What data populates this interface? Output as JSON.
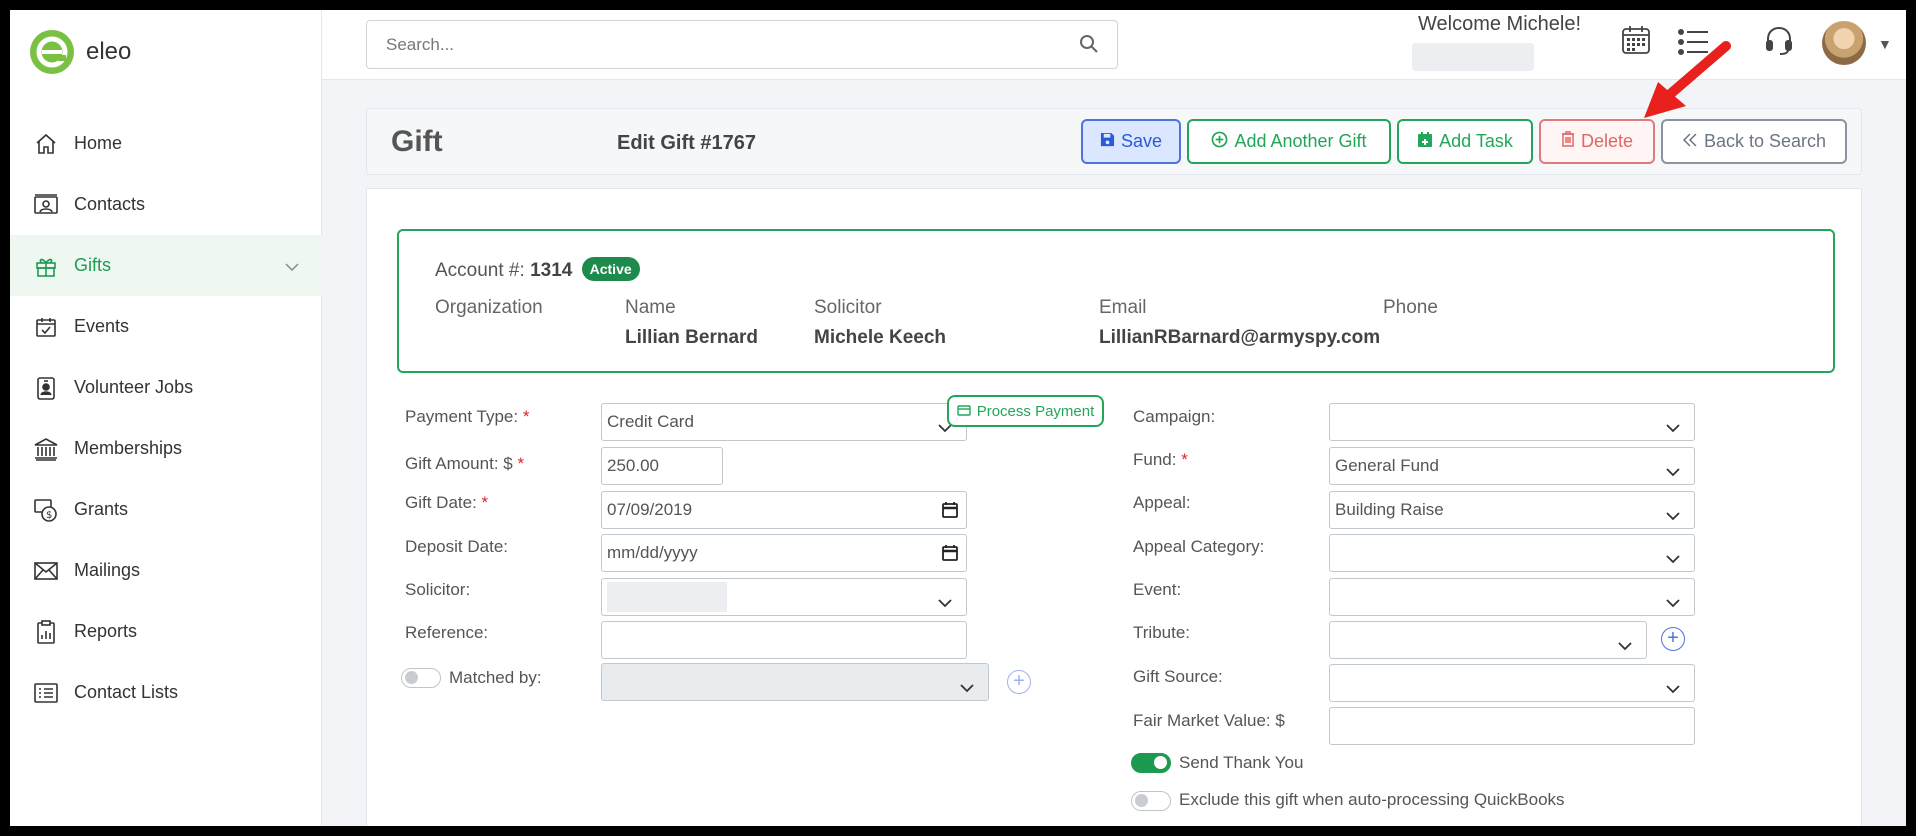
{
  "app": {
    "logo_text": "eleo"
  },
  "sidebar": {
    "items": [
      {
        "label": "Home",
        "icon": "home-icon"
      },
      {
        "label": "Contacts",
        "icon": "contact-card-icon"
      },
      {
        "label": "Gifts",
        "icon": "gift-icon",
        "active": true
      },
      {
        "label": "Events",
        "icon": "calendar-check-icon"
      },
      {
        "label": "Volunteer Jobs",
        "icon": "id-badge-icon"
      },
      {
        "label": "Memberships",
        "icon": "institution-icon"
      },
      {
        "label": "Grants",
        "icon": "money-bag-icon"
      },
      {
        "label": "Mailings",
        "icon": "envelope-icon"
      },
      {
        "label": "Reports",
        "icon": "report-icon"
      },
      {
        "label": "Contact Lists",
        "icon": "list-icon"
      }
    ]
  },
  "topbar": {
    "search_placeholder": "Search...",
    "welcome": "Welcome Michele!"
  },
  "header": {
    "title": "Gift",
    "subtitle": "Edit Gift #1767",
    "buttons": {
      "save": "Save",
      "add_another": "Add Another Gift",
      "add_task": "Add Task",
      "delete": "Delete",
      "back": "Back to Search"
    }
  },
  "account": {
    "label": "Account #:",
    "number": "1314",
    "status": "Active",
    "columns": {
      "organization": {
        "label": "Organization",
        "value": ""
      },
      "name": {
        "label": "Name",
        "value": "Lillian Bernard"
      },
      "solicitor": {
        "label": "Solicitor",
        "value": "Michele Keech"
      },
      "email": {
        "label": "Email",
        "value": "LillianRBarnard@armyspy.com"
      },
      "phone": {
        "label": "Phone",
        "value": ""
      }
    }
  },
  "form_left": {
    "payment_type": {
      "label": "Payment Type:",
      "value": "Credit Card"
    },
    "gift_amount": {
      "label": "Gift Amount: $",
      "value": "250.00"
    },
    "process_payment": "Process Payment",
    "gift_date": {
      "label": "Gift Date:",
      "value": "07/09/2019"
    },
    "deposit_date": {
      "label": "Deposit Date:",
      "placeholder": "mm/dd/yyyy"
    },
    "solicitor": {
      "label": "Solicitor:",
      "value": ""
    },
    "reference": {
      "label": "Reference:",
      "value": ""
    },
    "matched_by": {
      "label": "Matched by:",
      "value": "",
      "enabled": false
    }
  },
  "form_right": {
    "campaign": {
      "label": "Campaign:",
      "value": ""
    },
    "fund": {
      "label": "Fund:",
      "value": "General Fund"
    },
    "appeal": {
      "label": "Appeal:",
      "value": "Building Raise"
    },
    "appeal_category": {
      "label": "Appeal Category:",
      "value": ""
    },
    "event": {
      "label": "Event:",
      "value": ""
    },
    "tribute": {
      "label": "Tribute:",
      "value": ""
    },
    "gift_source": {
      "label": "Gift Source:",
      "value": ""
    },
    "fair_market_value": {
      "label": "Fair Market Value: $",
      "value": ""
    },
    "send_thank_you": {
      "label": "Send Thank You",
      "on": true
    },
    "exclude_quickbooks": {
      "label": "Exclude this gift when auto-processing QuickBooks",
      "on": false
    }
  },
  "required_mark": "*",
  "colors": {
    "brand_green": "#23a55a",
    "primary_blue": "#4e73df",
    "danger_red": "#e06666",
    "annotation_red": "#e8211d"
  }
}
